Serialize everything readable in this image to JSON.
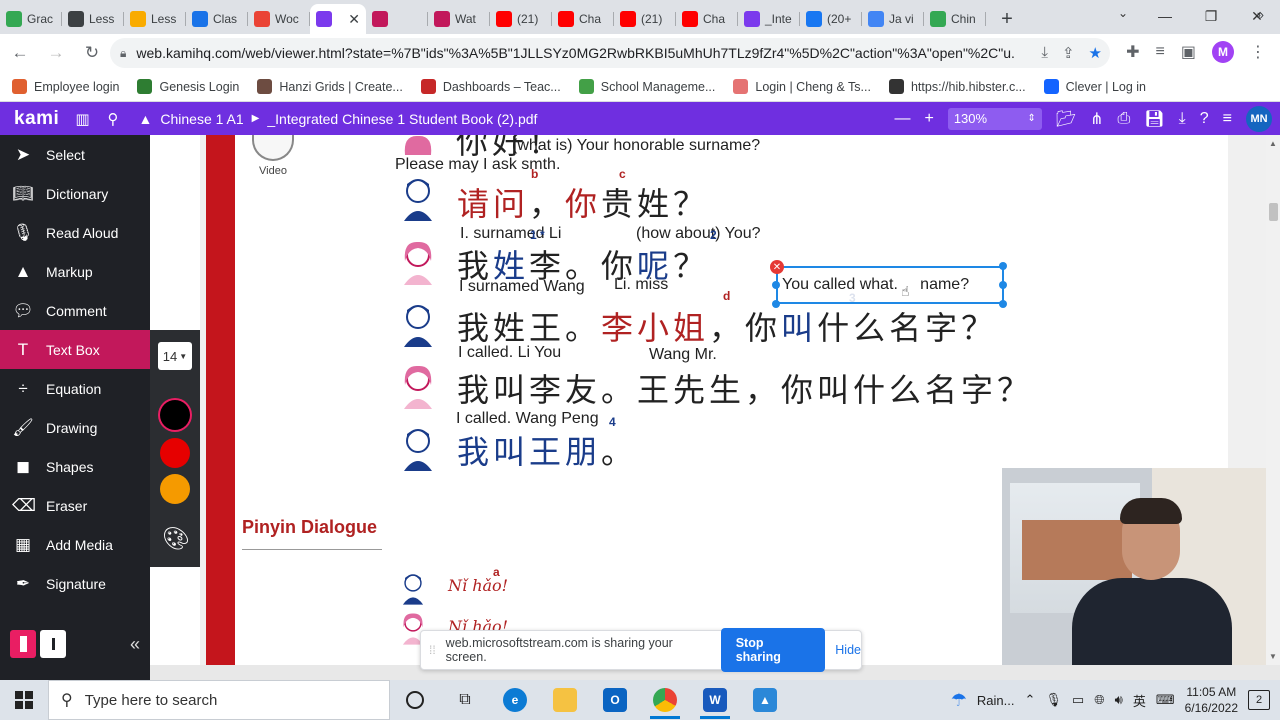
{
  "browser": {
    "tabs": [
      {
        "label": "Grac",
        "icon": "google-classroom-icon",
        "color": "#34a853"
      },
      {
        "label": "Less",
        "icon": "lesson-icon",
        "color": "#3c4043"
      },
      {
        "label": "Less",
        "icon": "lesson-icon",
        "color": "#f9ab00"
      },
      {
        "label": "Clas",
        "icon": "classroom-icon",
        "color": "#1a73e8"
      },
      {
        "label": "Woc",
        "icon": "gmail-icon",
        "color": "#ea4335"
      },
      {
        "label": "",
        "icon": "kami-icon",
        "color": "#7b3aed",
        "active": true
      },
      {
        "label": "",
        "icon": "play-icon",
        "color": "#c2185b"
      },
      {
        "label": "Wat",
        "icon": "play-icon",
        "color": "#c2185b"
      },
      {
        "label": "(21)",
        "icon": "youtube-icon",
        "color": "#ff0000"
      },
      {
        "label": "Cha",
        "icon": "youtube-icon",
        "color": "#ff0000"
      },
      {
        "label": "(21)",
        "icon": "youtube-icon",
        "color": "#ff0000"
      },
      {
        "label": "Cha",
        "icon": "youtube-icon",
        "color": "#ff0000"
      },
      {
        "label": "_Inte",
        "icon": "kami-icon",
        "color": "#7b3aed"
      },
      {
        "label": "(20+",
        "icon": "facebook-icon",
        "color": "#1877f2"
      },
      {
        "label": "Ja vi",
        "icon": "docs-icon",
        "color": "#4285f4"
      },
      {
        "label": "Chin",
        "icon": "chrome-icon",
        "color": "#34a853"
      }
    ],
    "url": "web.kamihq.com/web/viewer.html?state=%7B\"ids\"%3A%5B\"1JLLSYz0MG2RwbRKBI5uMhUh7TLz9fZr4\"%5D%2C\"action\"%3A\"open\"%2C\"u...",
    "profile_initial": "M",
    "bookmarks": [
      {
        "label": "Employee login",
        "icon": "employee-icon",
        "color": "#e06030"
      },
      {
        "label": "Genesis Login",
        "icon": "genesis-icon",
        "color": "#2e7d32"
      },
      {
        "label": "Hanzi Grids | Create...",
        "icon": "hanzi-icon",
        "color": "#6d4c41"
      },
      {
        "label": "Dashboards – Teac...",
        "icon": "dashboard-icon",
        "color": "#c62828"
      },
      {
        "label": "School Manageme...",
        "icon": "school-icon",
        "color": "#43a047"
      },
      {
        "label": "Login | Cheng & Ts...",
        "icon": "cheng-tsui-icon",
        "color": "#e57373"
      },
      {
        "label": "https://hib.hibster.c...",
        "icon": "hibster-icon",
        "color": "#333333"
      },
      {
        "label": "Clever | Log in",
        "icon": "clever-icon",
        "color": "#1464ff"
      }
    ]
  },
  "kami": {
    "logo": "kami",
    "folder": "Chinese 1 A1",
    "document": "_Integrated Chinese 1 Student Book (2).pdf",
    "zoom": "130%",
    "user_initials": "MN",
    "accent": "#6f2fe0"
  },
  "sidebar": {
    "items": [
      {
        "label": "Select",
        "icon": "cursor-icon"
      },
      {
        "label": "Dictionary",
        "icon": "book-icon"
      },
      {
        "label": "Read Aloud",
        "icon": "speaker-icon"
      },
      {
        "label": "Markup",
        "icon": "highlighter-icon"
      },
      {
        "label": "Comment",
        "icon": "comment-icon"
      },
      {
        "label": "Text Box",
        "icon": "text-icon",
        "active": true
      },
      {
        "label": "Equation",
        "icon": "divide-icon"
      },
      {
        "label": "Drawing",
        "icon": "brush-icon"
      },
      {
        "label": "Shapes",
        "icon": "shapes-icon"
      },
      {
        "label": "Eraser",
        "icon": "eraser-icon"
      },
      {
        "label": "Add Media",
        "icon": "media-icon"
      },
      {
        "label": "Signature",
        "icon": "pen-nib-icon"
      }
    ]
  },
  "textbox_options": {
    "font_size": "14",
    "colors": [
      "#000000",
      "#e60000",
      "#f59a00"
    ]
  },
  "document": {
    "video_label": "Video",
    "lines": {
      "l0_cn": "你好！",
      "l0_note_top": "(what is) Your honorable surname?",
      "l0_note": "Please may I ask smth.",
      "l1_cn_a": "请问",
      "l1_cn_b": "，",
      "l1_cn_c": "你",
      "l1_cn_d": "贵姓？",
      "l1_note_a": "I.   surnamed Li",
      "l1_note_b": "(how about) You?",
      "l2_cn_a": "我",
      "l2_cn_b": "姓",
      "l2_cn_c": "李。你",
      "l2_cn_d": "呢",
      "l2_cn_e": "？",
      "l2_note_a": "I surnamed Wang",
      "l2_note_b": "Li. miss",
      "l3_cn_a": "我姓王。",
      "l3_cn_b": "李小姐",
      "l3_cn_c": "，你",
      "l3_cn_d": "叫",
      "l3_cn_e": "什么名字？",
      "l3_note_a": "I called.   Li   You",
      "l3_note_b": "Wang Mr.",
      "l4_cn": "我叫李友。王先生，你叫什么名字？",
      "l4_note": "I called.     Wang Peng",
      "l5_cn_a": "我叫王朋",
      "l5_cn_b": "。"
    },
    "superscripts": {
      "b": "b",
      "c": "c",
      "one_star": "1 *",
      "two": "2",
      "d": "d",
      "three": "3",
      "four": "4"
    },
    "pinyin_heading": "Pinyin Dialogue",
    "pinyin_lines": [
      "Nǐ hǎo!",
      "Nǐ hǎo!"
    ],
    "pinyin_sup": "a",
    "annotation_text": "You called what.     name?"
  },
  "share_bar": {
    "message": "web.microsoftstream.com is sharing your screen.",
    "stop": "Stop sharing",
    "hide": "Hide"
  },
  "taskbar": {
    "search_placeholder": "Type here to search",
    "weather": "Rain...",
    "ime": "英",
    "time": "11:05 AM",
    "date": "6/16/2022",
    "notifications": "2"
  }
}
